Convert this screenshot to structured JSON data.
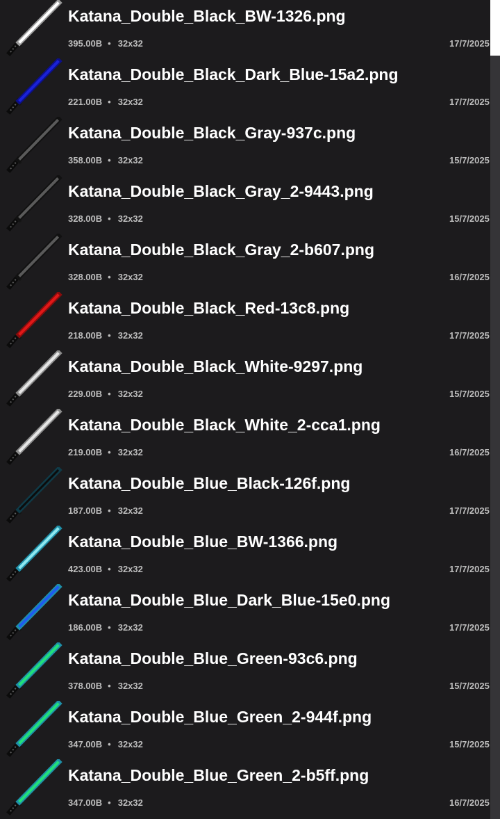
{
  "files": [
    {
      "name": "Katana_Double_Black_BW-1326.png",
      "size": "395.00B",
      "dims": "32x32",
      "date": "17/7/2025",
      "blade_style": "bw",
      "blade_color": "#ffffff",
      "glow_color": "#9a9a9a"
    },
    {
      "name": "Katana_Double_Black_Dark_Blue-15a2.png",
      "size": "221.00B",
      "dims": "32x32",
      "date": "17/7/2025",
      "blade_style": "solid",
      "blade_color": "#1a22d6",
      "glow_color": "#0c0f8a"
    },
    {
      "name": "Katana_Double_Black_Gray-937c.png",
      "size": "358.00B",
      "dims": "32x32",
      "date": "15/7/2025",
      "blade_style": "dashed",
      "blade_color": "#5a5a5a",
      "glow_color": "#2a2a2a"
    },
    {
      "name": "Katana_Double_Black_Gray_2-9443.png",
      "size": "328.00B",
      "dims": "32x32",
      "date": "15/7/2025",
      "blade_style": "dashed",
      "blade_color": "#5a5a5a",
      "glow_color": "#2a2a2a"
    },
    {
      "name": "Katana_Double_Black_Gray_2-b607.png",
      "size": "328.00B",
      "dims": "32x32",
      "date": "16/7/2025",
      "blade_style": "dashed",
      "blade_color": "#5a5a5a",
      "glow_color": "#2a2a2a"
    },
    {
      "name": "Katana_Double_Black_Red-13c8.png",
      "size": "218.00B",
      "dims": "32x32",
      "date": "17/7/2025",
      "blade_style": "solid",
      "blade_color": "#e01818",
      "glow_color": "#8a0c0c"
    },
    {
      "name": "Katana_Double_Black_White-9297.png",
      "size": "229.00B",
      "dims": "32x32",
      "date": "15/7/2025",
      "blade_style": "solid",
      "blade_color": "#e6e6e6",
      "glow_color": "#8c8c8c"
    },
    {
      "name": "Katana_Double_Black_White_2-cca1.png",
      "size": "219.00B",
      "dims": "32x32",
      "date": "16/7/2025",
      "blade_style": "solid",
      "blade_color": "#e6e6e6",
      "glow_color": "#8c8c8c"
    },
    {
      "name": "Katana_Double_Blue_Black-126f.png",
      "size": "187.00B",
      "dims": "32x32",
      "date": "17/7/2025",
      "blade_style": "outline",
      "blade_color": "#1e8fa8",
      "glow_color": "#0f3b48"
    },
    {
      "name": "Katana_Double_Blue_BW-1366.png",
      "size": "423.00B",
      "dims": "32x32",
      "date": "17/7/2025",
      "blade_style": "bw",
      "blade_color": "#8ee8f0",
      "glow_color": "#1e8fa8"
    },
    {
      "name": "Katana_Double_Blue_Dark_Blue-15e0.png",
      "size": "186.00B",
      "dims": "32x32",
      "date": "17/7/2025",
      "blade_style": "solid",
      "blade_color": "#1e5cf0",
      "glow_color": "#1e8fa8"
    },
    {
      "name": "Katana_Double_Blue_Green-93c6.png",
      "size": "378.00B",
      "dims": "32x32",
      "date": "15/7/2025",
      "blade_style": "solid",
      "blade_color": "#22e07a",
      "glow_color": "#1e8fa8"
    },
    {
      "name": "Katana_Double_Blue_Green_2-944f.png",
      "size": "347.00B",
      "dims": "32x32",
      "date": "15/7/2025",
      "blade_style": "solid",
      "blade_color": "#22e07a",
      "glow_color": "#1e8fa8"
    },
    {
      "name": "Katana_Double_Blue_Green_2-b5ff.png",
      "size": "347.00B",
      "dims": "32x32",
      "date": "16/7/2025",
      "blade_style": "solid",
      "blade_color": "#22e07a",
      "glow_color": "#1e8fa8"
    }
  ],
  "separator": "•"
}
